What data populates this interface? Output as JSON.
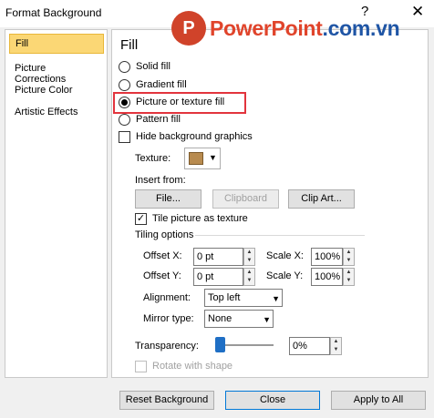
{
  "window": {
    "title": "Format Background",
    "help_glyph": "?",
    "close_glyph": "✕"
  },
  "watermark": {
    "logo_letter": "P",
    "brand": "PowerPoint",
    "domain": ".com.vn"
  },
  "sidebar": {
    "items": [
      {
        "label": "Fill",
        "active": true
      },
      {
        "label": "Picture Corrections",
        "active": false
      },
      {
        "label": "Picture Color",
        "active": false
      },
      {
        "label": "Artistic Effects",
        "active": false
      }
    ]
  },
  "fill": {
    "heading": "Fill",
    "options": [
      {
        "label": "Solid fill",
        "selected": false
      },
      {
        "label": "Gradient fill",
        "selected": false
      },
      {
        "label": "Picture or texture fill",
        "selected": true
      },
      {
        "label": "Pattern fill",
        "selected": false
      }
    ],
    "hide_background_label": "Hide background graphics",
    "hide_background_checked": false,
    "texture_label": "Texture:",
    "insert_from_label": "Insert from:",
    "file_button": "File...",
    "clipboard_button": "Clipboard",
    "clipart_button": "Clip Art...",
    "tile_label": "Tile picture as texture",
    "tile_checked": true,
    "tiling_options_label": "Tiling options",
    "offset_x_label": "Offset X:",
    "offset_x_value": "0 pt",
    "scale_x_label": "Scale X:",
    "scale_x_value": "100%",
    "offset_y_label": "Offset Y:",
    "offset_y_value": "0 pt",
    "scale_y_label": "Scale Y:",
    "scale_y_value": "100%",
    "alignment_label": "Alignment:",
    "alignment_value": "Top left",
    "mirror_label": "Mirror type:",
    "mirror_value": "None",
    "transparency_label": "Transparency:",
    "transparency_value": "0%",
    "rotate_label": "Rotate with shape"
  },
  "footer": {
    "reset_button": "Reset Background",
    "close_button": "Close",
    "apply_all_button": "Apply to All"
  },
  "colors": {
    "accent": "#0078d7",
    "highlight": "#e2343d",
    "active_tab": "#fbd775"
  }
}
